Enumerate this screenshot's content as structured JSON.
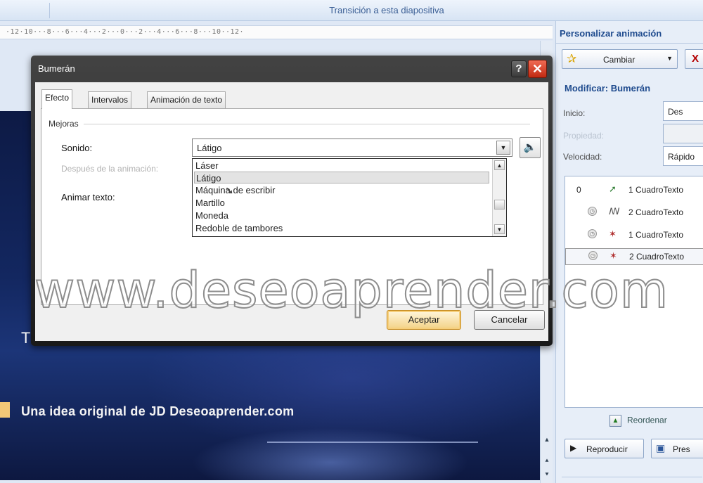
{
  "top_bar": {
    "caption": "Transición a esta diapositiva"
  },
  "ruler": {
    "numbers": "·12·10···8···6···4···2···0···2···4···6···8···10··12·"
  },
  "slide": {
    "partial_text": "T",
    "footer_text": "Una idea original de JD Deseoaprender.com"
  },
  "watermark": "www.deseoaprender.com",
  "dialog": {
    "title": "Bumerán",
    "help_label": "?",
    "close_label": "✕",
    "tabs": [
      {
        "label": "Efecto"
      },
      {
        "label": "Intervalos"
      },
      {
        "label": "Animación de texto"
      }
    ],
    "section_label": "Mejoras",
    "sound_label": "Sonido:",
    "after_anim_label": "Después de la animación:",
    "animate_text_label": "Animar texto:",
    "sound_value": "Látigo",
    "sound_options": [
      "Láser",
      "Látigo",
      "Máquina de escribir",
      "Martillo",
      "Moneda",
      "Redoble de tambores"
    ],
    "hovered_option": "Látigo",
    "ok_label": "Aceptar",
    "cancel_label": "Cancelar"
  },
  "task_pane": {
    "title": "Personalizar animación",
    "change_label": "Cambiar",
    "remove_label": "X",
    "modify_title": "Modificar: Bumerán",
    "start_label": "Inicio:",
    "start_value": "Des",
    "property_label": "Propiedad:",
    "speed_label": "Velocidad:",
    "speed_value": "Rápido",
    "list_items": [
      {
        "number": "0",
        "name": "1 CuadroTexto"
      },
      {
        "number": "",
        "name": "2 CuadroTexto"
      },
      {
        "number": "",
        "name": "1 CuadroTexto"
      },
      {
        "number": "",
        "name": "2 CuadroTexto"
      }
    ],
    "reorder_label": "Reordenar",
    "play_label": "Reproducir",
    "presentation_label": "Pres"
  }
}
